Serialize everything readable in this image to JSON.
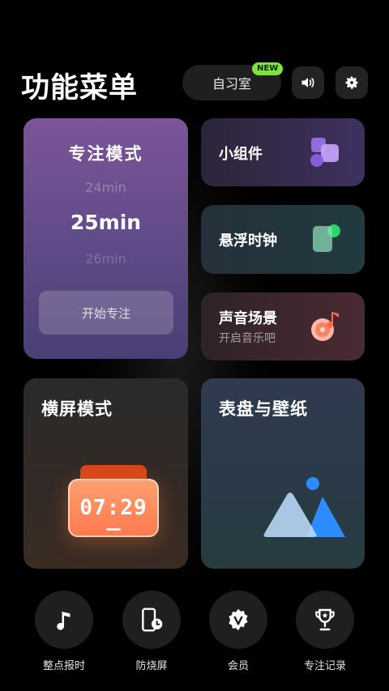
{
  "header": {
    "title": "功能菜单",
    "study_room_label": "自习室",
    "new_badge": "NEW",
    "icons": [
      "volume-icon",
      "gear-icon"
    ]
  },
  "focus_card": {
    "title": "专注模式",
    "picker_prev": "24min",
    "picker_current": "25min",
    "picker_next": "26min",
    "start_button": "开始专注",
    "accent": "#7b5598"
  },
  "widgets_card": {
    "title": "小组件",
    "icon": "widgets-icon"
  },
  "floating_clock_card": {
    "title": "悬浮时钟",
    "icon": "floating-clock-icon"
  },
  "sound_card": {
    "title": "声音场景",
    "subtitle": "开启音乐吧",
    "icon": "music-disc-icon"
  },
  "landscape_card": {
    "title": "横屏模式",
    "clock_time": "07:29"
  },
  "wallpaper_card": {
    "title": "表盘与壁纸",
    "icon": "mountain-picture-icon"
  },
  "bottom_bar": [
    {
      "label": "整点报时",
      "icon": "music-note-icon"
    },
    {
      "label": "防烧屏",
      "icon": "phone-clock-icon"
    },
    {
      "label": "会员",
      "icon": "vip-badge-icon"
    },
    {
      "label": "专注记录",
      "icon": "trophy-icon"
    }
  ],
  "colors": {
    "background": "#000000",
    "new_badge": "#7ee33a",
    "clock_orange": "#ff7a50",
    "wallpaper_blue": "#2f8cff"
  }
}
